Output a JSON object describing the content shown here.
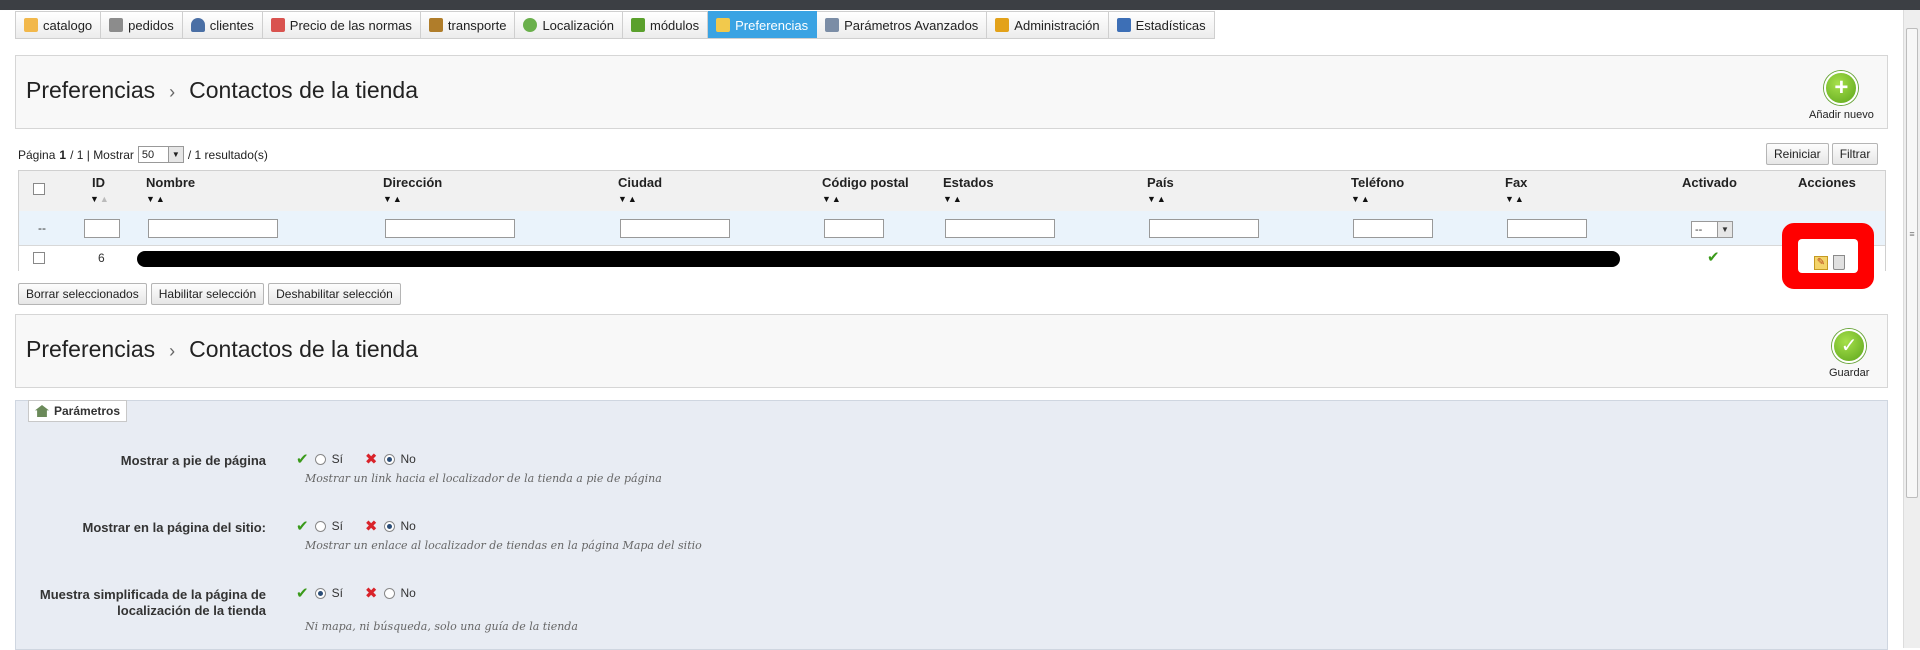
{
  "tabs": [
    {
      "label": "catalogo",
      "icon": "folder-icon",
      "color": "#f2b84b"
    },
    {
      "label": "pedidos",
      "icon": "cart-icon",
      "color": "#8c8c8c"
    },
    {
      "label": "clientes",
      "icon": "user-icon",
      "color": "#4a6fa5"
    },
    {
      "label": "Precio de las normas",
      "icon": "price-rules-icon",
      "color": "#d9534f"
    },
    {
      "label": "transporte",
      "icon": "truck-icon",
      "color": "#b07d2a"
    },
    {
      "label": "Localización",
      "icon": "globe-icon",
      "color": "#6ab04c"
    },
    {
      "label": "módulos",
      "icon": "puzzle-icon",
      "color": "#5aa02c"
    },
    {
      "label": "Preferencias",
      "icon": "preferences-icon",
      "color": "#f2c94c",
      "active": true
    },
    {
      "label": "Parámetros Avanzados",
      "icon": "wrench-icon",
      "color": "#7b8da6"
    },
    {
      "label": "Administración",
      "icon": "key-icon",
      "color": "#e3a21a"
    },
    {
      "label": "Estadísticas",
      "icon": "chart-icon",
      "color": "#3d6fb6"
    }
  ],
  "list_header": {
    "crumb_parent": "Preferencias",
    "crumb_sep": "›",
    "crumb_current": "Contactos de la tienda",
    "add_new_label": "Añadir nuevo"
  },
  "pagination": {
    "page_prefix": "Página",
    "page_current": "1",
    "page_total": "/ 1 | Mostrar",
    "per_page": "50",
    "results": "/ 1 resultado(s)",
    "reset_label": "Reiniciar",
    "filter_label": "Filtrar"
  },
  "table": {
    "columns": [
      {
        "key": "id",
        "label": "ID"
      },
      {
        "key": "name",
        "label": "Nombre"
      },
      {
        "key": "address",
        "label": "Dirección"
      },
      {
        "key": "city",
        "label": "Ciudad"
      },
      {
        "key": "postcode",
        "label": "Código postal"
      },
      {
        "key": "state",
        "label": "Estados"
      },
      {
        "key": "country",
        "label": "País"
      },
      {
        "key": "phone",
        "label": "Teléfono"
      },
      {
        "key": "fax",
        "label": "Fax"
      },
      {
        "key": "active",
        "label": "Activado"
      },
      {
        "key": "actions",
        "label": "Acciones"
      }
    ],
    "filter_placeholder": "--",
    "active_filter_value": "--",
    "rows": [
      {
        "id": "6",
        "active": "✔"
      }
    ]
  },
  "bulk_actions": {
    "delete": "Borrar seleccionados",
    "enable": "Habilitar selección",
    "disable": "Deshabilitar selección"
  },
  "form_header": {
    "crumb_parent": "Preferencias",
    "crumb_sep": "›",
    "crumb_current": "Contactos de la tienda",
    "save_label": "Guardar"
  },
  "params": {
    "legend": "Parámetros",
    "yes_label": "Sí",
    "no_label": "No",
    "fields": [
      {
        "label": "Mostrar a pie de página",
        "value": "No",
        "hint": "Mostrar un link hacia el localizador de la tienda a pie de página"
      },
      {
        "label": "Mostrar en la página del sitio:",
        "value": "No",
        "hint": "Mostrar un enlace al localizador de tiendas en la página Mapa del sitio"
      },
      {
        "label": "Muestra simplificada de la página de localización de la tienda",
        "value": "Sí",
        "hint": "Ni mapa, ni búsqueda, solo una guía de la tienda"
      }
    ]
  }
}
